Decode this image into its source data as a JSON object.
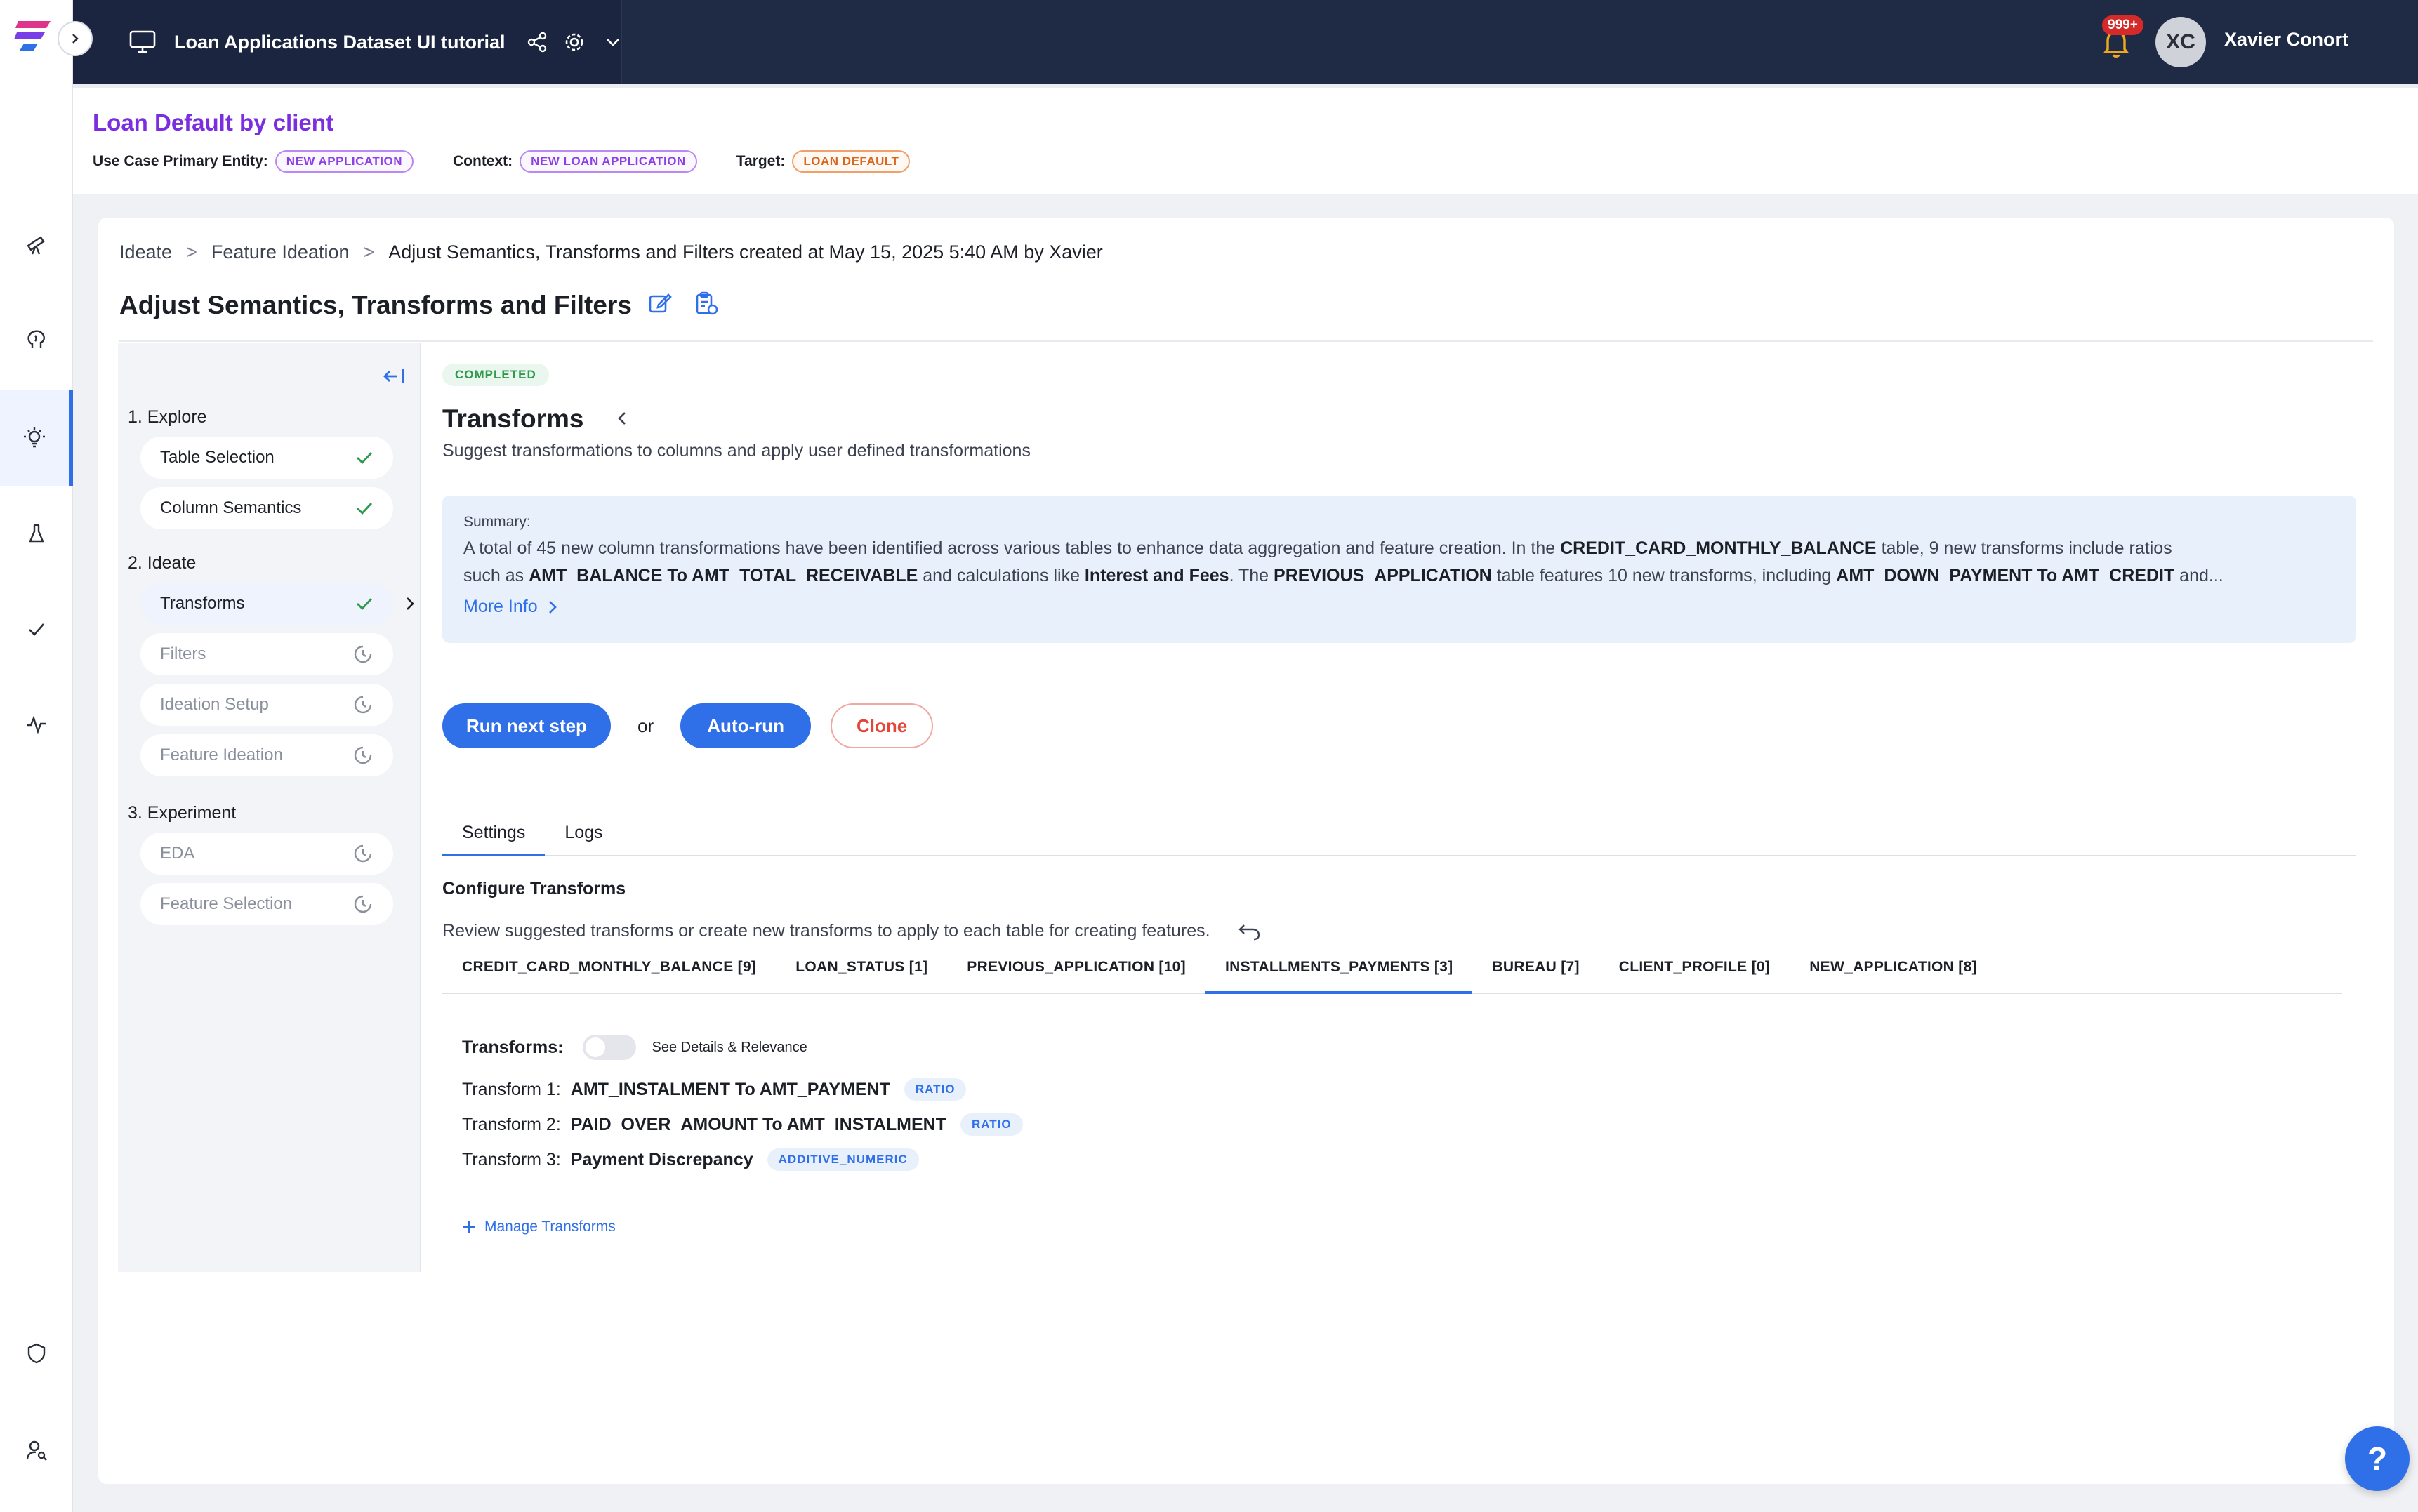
{
  "topbar": {
    "project_name": "Loan Applications Dataset UI tutorial",
    "notifications_badge": "999+",
    "user_initials": "XC",
    "user_name": "Xavier Conort"
  },
  "usecase": {
    "title": "Loan Default by client",
    "primary_entity_label": "Use Case Primary Entity:",
    "primary_entity_value": "NEW APPLICATION",
    "context_label": "Context:",
    "context_value": "NEW LOAN APPLICATION",
    "target_label": "Target:",
    "target_value": "LOAN DEFAULT"
  },
  "breadcrumb": {
    "items": [
      "Ideate",
      "Feature Ideation",
      "Adjust Semantics, Transforms and Filters created at May 15, 2025 5:40 AM by Xavier"
    ],
    "separator": ">"
  },
  "page": {
    "title": "Adjust Semantics, Transforms and Filters"
  },
  "steps": {
    "sections": [
      {
        "label": "1. Explore"
      },
      {
        "label": "2. Ideate"
      },
      {
        "label": "3. Experiment"
      }
    ],
    "items": [
      {
        "label": "Table Selection",
        "status": "done"
      },
      {
        "label": "Column Semantics",
        "status": "done"
      },
      {
        "label": "Transforms",
        "status": "done"
      },
      {
        "label": "Filters",
        "status": "pending"
      },
      {
        "label": "Ideation Setup",
        "status": "pending"
      },
      {
        "label": "Feature Ideation",
        "status": "pending"
      },
      {
        "label": "EDA",
        "status": "pending"
      },
      {
        "label": "Feature Selection",
        "status": "pending"
      }
    ]
  },
  "content": {
    "status": "COMPLETED",
    "title": "Transforms",
    "subtitle": "Suggest transformations to columns and apply user defined transformations",
    "summary_label": "Summary:",
    "summary_line1_a": "A total of 45 new column transformations have been identified across various tables to enhance data aggregation and feature creation. In the ",
    "summary_line1_b": "CREDIT_CARD_MONTHLY_BALANCE",
    "summary_line1_c": " table, 9 new transforms include ratios",
    "summary_line2_a": "such as ",
    "summary_line2_b": "AMT_BALANCE To AMT_TOTAL_RECEIVABLE",
    "summary_line2_c": " and calculations like ",
    "summary_line2_d": "Interest and Fees",
    "summary_line2_e": ". The ",
    "summary_line2_f": "PREVIOUS_APPLICATION",
    "summary_line2_g": " table features 10 new transforms, including ",
    "summary_line2_h": "AMT_DOWN_PAYMENT To AMT_CREDIT",
    "summary_line2_i": " and...",
    "more_info": "More Info"
  },
  "actions": {
    "run_next": "Run next step",
    "or": "or",
    "auto_run": "Auto-run",
    "clone": "Clone"
  },
  "tabs": [
    "Settings",
    "Logs"
  ],
  "configure": {
    "title": "Configure Transforms",
    "subtitle": "Review suggested transforms or create new transforms to apply to each table for creating features."
  },
  "table_tabs": [
    "CREDIT_CARD_MONTHLY_BALANCE [9]",
    "LOAN_STATUS [1]",
    "PREVIOUS_APPLICATION [10]",
    "INSTALLMENTS_PAYMENTS [3]",
    "BUREAU [7]",
    "CLIENT_PROFILE [0]",
    "NEW_APPLICATION [8]"
  ],
  "transforms": {
    "label": "Transforms:",
    "toggle_label": "See Details & Relevance",
    "items": [
      {
        "prefix": "Transform 1:",
        "name": "AMT_INSTALMENT To AMT_PAYMENT",
        "tag": "RATIO"
      },
      {
        "prefix": "Transform 2:",
        "name": "PAID_OVER_AMOUNT To AMT_INSTALMENT",
        "tag": "RATIO"
      },
      {
        "prefix": "Transform 3:",
        "name": "Payment Discrepancy",
        "tag": "ADDITIVE_NUMERIC"
      }
    ],
    "manage": "Manage Transforms"
  },
  "help": "?",
  "colors": {
    "accent": "#2f6fe8",
    "topbar": "#1f2a44",
    "usecase_title": "#7a2ee0",
    "done_check": "#2f9a4c",
    "clone": "#e2473a"
  }
}
